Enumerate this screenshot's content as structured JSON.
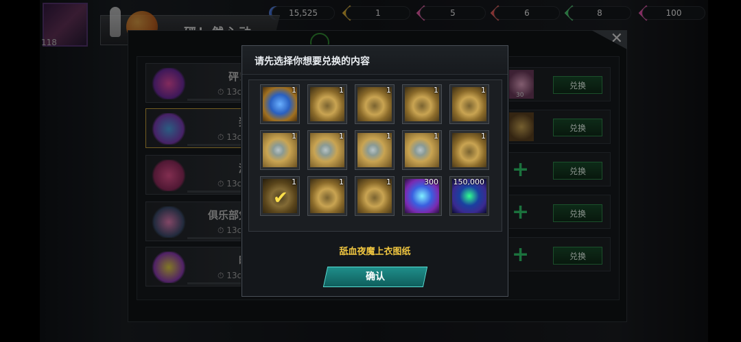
{
  "player": {
    "level": "118"
  },
  "currency": [
    {
      "icon": "coin-icon",
      "value": "15,525",
      "color": "#3a6ad0"
    },
    {
      "icon": "gem-gold-icon",
      "value": "1",
      "color": "#d0a020"
    },
    {
      "icon": "gem-pink-icon",
      "value": "5",
      "color": "#e04a9a"
    },
    {
      "icon": "gem-red-icon",
      "value": "6",
      "color": "#e04a4a"
    },
    {
      "icon": "gem-green-icon",
      "value": "8",
      "color": "#3ac060"
    },
    {
      "icon": "ticket-icon",
      "value": "100",
      "color": "#e040a0"
    }
  ],
  "event": {
    "title": "砰！然心动"
  },
  "left_list": [
    {
      "label": "砰！",
      "timer": "13c"
    },
    {
      "label": "奖",
      "timer": "13c"
    },
    {
      "label": "游",
      "timer": "13c"
    },
    {
      "label": "俱乐部凭",
      "timer": "13c"
    },
    {
      "label": "时",
      "timer": "13c"
    }
  ],
  "right_list": [
    {
      "qty": "30",
      "button": "兑换",
      "type": "item"
    },
    {
      "qty": "",
      "button": "兑换",
      "type": "item"
    },
    {
      "qty": "",
      "button": "兑换",
      "type": "plus"
    },
    {
      "qty": "",
      "button": "兑换",
      "type": "plus"
    },
    {
      "qty": "",
      "button": "兑换",
      "type": "plus"
    }
  ],
  "bottom_hint": "",
  "dialog": {
    "title": "请先选择你想要兑换的内容",
    "selected_item_name": "舐血夜魔上衣图纸",
    "confirm_label": "确认",
    "items": [
      {
        "qty": "1",
        "art": "chest",
        "icon": "treasure-chest-icon"
      },
      {
        "qty": "1",
        "art": "gold",
        "icon": "blueprint-icon"
      },
      {
        "qty": "1",
        "art": "gold",
        "icon": "blueprint-icon"
      },
      {
        "qty": "1",
        "art": "gold",
        "icon": "blueprint-icon"
      },
      {
        "qty": "1",
        "art": "gold",
        "icon": "blueprint-icon"
      },
      {
        "qty": "1",
        "art": "gold2",
        "icon": "blueprint-icon"
      },
      {
        "qty": "1",
        "art": "gold2",
        "icon": "blueprint-icon"
      },
      {
        "qty": "1",
        "art": "gold2",
        "icon": "blueprint-icon"
      },
      {
        "qty": "1",
        "art": "gold2",
        "icon": "blueprint-icon"
      },
      {
        "qty": "1",
        "art": "gold",
        "icon": "blueprint-icon"
      },
      {
        "qty": "1",
        "art": "gold",
        "icon": "blueprint-icon",
        "selected": true
      },
      {
        "qty": "1",
        "art": "gold",
        "icon": "blueprint-icon"
      },
      {
        "qty": "1",
        "art": "gold",
        "icon": "blueprint-icon"
      },
      {
        "qty": "300",
        "art": "dna",
        "icon": "dna-icon"
      },
      {
        "qty": "150,000",
        "art": "gear",
        "icon": "gear-core-icon"
      }
    ]
  }
}
